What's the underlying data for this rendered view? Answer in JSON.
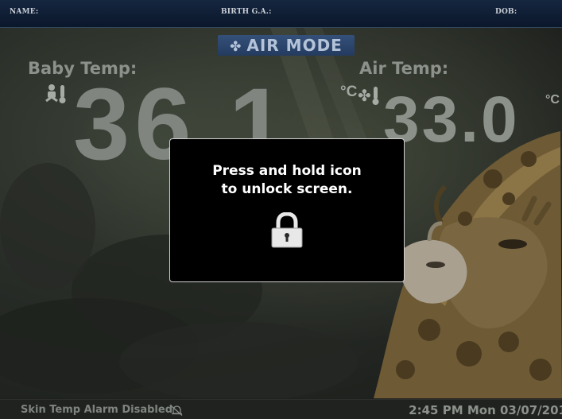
{
  "patient_bar": {
    "name_label": "NAME:",
    "birth_label": "BIRTH G.A.:",
    "dob_label": "DOB:"
  },
  "mode": {
    "label": "AIR MODE",
    "icon": "fan-icon"
  },
  "baby_temp": {
    "label": "Baby Temp:",
    "value": "36.1",
    "unit": "°C",
    "icon": "baby-thermometer-icon"
  },
  "air_temp": {
    "label": "Air Temp:",
    "value": "33.0",
    "unit": "°C",
    "icon": "fan-thermometer-icon"
  },
  "lock_dialog": {
    "line1": "Press and hold icon",
    "line2": "to unlock screen.",
    "icon": "padlock-icon"
  },
  "status": {
    "alarm_text": "Skin Temp Alarm Disabled",
    "alarm_icon": "alarm-muted-icon",
    "clock": "2:45 PM Mon 03/07/201"
  },
  "colors": {
    "top_bar": "#0e1b30",
    "mode_badge": "#2c4770",
    "dialog_bg": "#000000",
    "dialog_border": "#d0d0d0"
  }
}
